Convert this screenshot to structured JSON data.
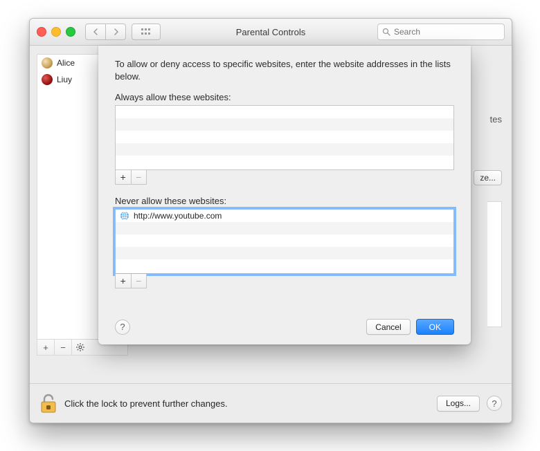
{
  "window": {
    "title": "Parental Controls",
    "search_placeholder": "Search"
  },
  "sidebar": {
    "items": [
      {
        "label": "Alice"
      },
      {
        "label": "Liuy"
      }
    ],
    "add_label": "+",
    "remove_label": "−",
    "gear_label": "✽"
  },
  "right": {
    "partial_label": "tes",
    "customize_partial": "ze..."
  },
  "lock": {
    "text": "Click the lock to prevent further changes.",
    "logs_label": "Logs..."
  },
  "sheet": {
    "description": "To allow or deny access to specific websites, enter the website addresses in the lists below.",
    "allow_label": "Always allow these websites:",
    "deny_label": "Never allow these websites:",
    "deny_items": [
      {
        "url": "http://www.youtube.com"
      }
    ],
    "add_label": "+",
    "remove_label": "−",
    "help_label": "?",
    "cancel_label": "Cancel",
    "ok_label": "OK"
  }
}
